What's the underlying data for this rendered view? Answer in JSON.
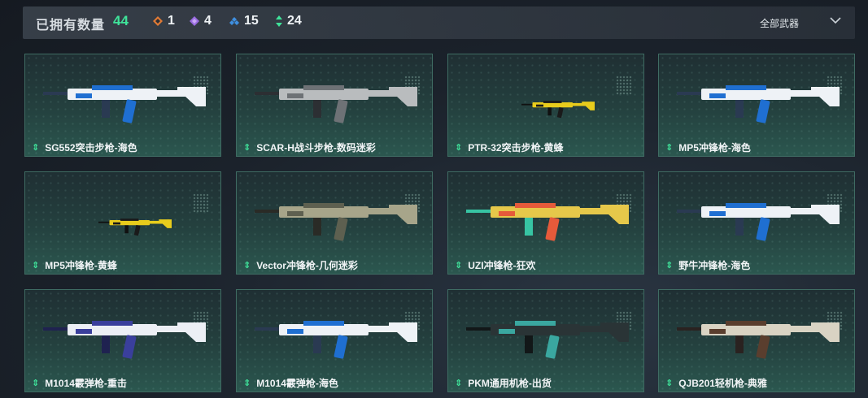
{
  "header": {
    "title": "已拥有数量",
    "count": "44",
    "stats": [
      {
        "icon": "orange-diamond-icon",
        "value": "1",
        "color": "#e07a35"
      },
      {
        "icon": "purple-diamond-icon",
        "value": "4",
        "color": "#9a6ce0"
      },
      {
        "icon": "blue-tri-diamond-icon",
        "value": "15",
        "color": "#3f8fe0"
      },
      {
        "icon": "green-arrows-icon",
        "value": "24",
        "color": "#3fe39a"
      }
    ],
    "filter_label": "全部武器"
  },
  "weapons": [
    {
      "name": "SG552突击步枪-海色",
      "skin": "blue-white"
    },
    {
      "name": "SCAR-H战斗步枪-数码迷彩",
      "skin": "digital-camo"
    },
    {
      "name": "PTR-32突击步枪-黄蜂",
      "skin": "yellow-black"
    },
    {
      "name": "MP5冲锋枪-海色",
      "skin": "blue-white"
    },
    {
      "name": "MP5冲锋枪-黄蜂",
      "skin": "yellow-black"
    },
    {
      "name": "Vector冲锋枪-几何迷彩",
      "skin": "geo-camo"
    },
    {
      "name": "UZI冲锋枪-狂欢",
      "skin": "carnival"
    },
    {
      "name": "野牛冲锋枪-海色",
      "skin": "blue-white"
    },
    {
      "name": "M1014霰弹枪-重击",
      "skin": "purple-white"
    },
    {
      "name": "M1014霰弹枪-海色",
      "skin": "blue-white"
    },
    {
      "name": "PKM通用机枪-出货",
      "skin": "dark-teal"
    },
    {
      "name": "QJB201轻机枪-典雅",
      "skin": "beige-brown"
    }
  ]
}
